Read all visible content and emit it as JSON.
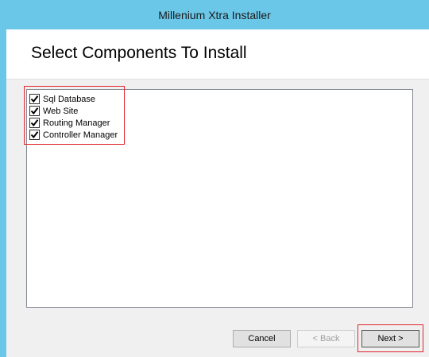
{
  "window": {
    "title": "Millenium Xtra Installer"
  },
  "header": {
    "title": "Select Components To Install"
  },
  "components": [
    {
      "label": "Sql Database",
      "checked": true
    },
    {
      "label": "Web Site",
      "checked": true
    },
    {
      "label": "Routing Manager",
      "checked": true
    },
    {
      "label": "Controller Manager",
      "checked": true
    }
  ],
  "buttons": {
    "cancel": "Cancel",
    "back": "< Back",
    "next": "Next >"
  },
  "colors": {
    "titlebar": "#6bc7e8",
    "highlight": "#e0242b"
  }
}
